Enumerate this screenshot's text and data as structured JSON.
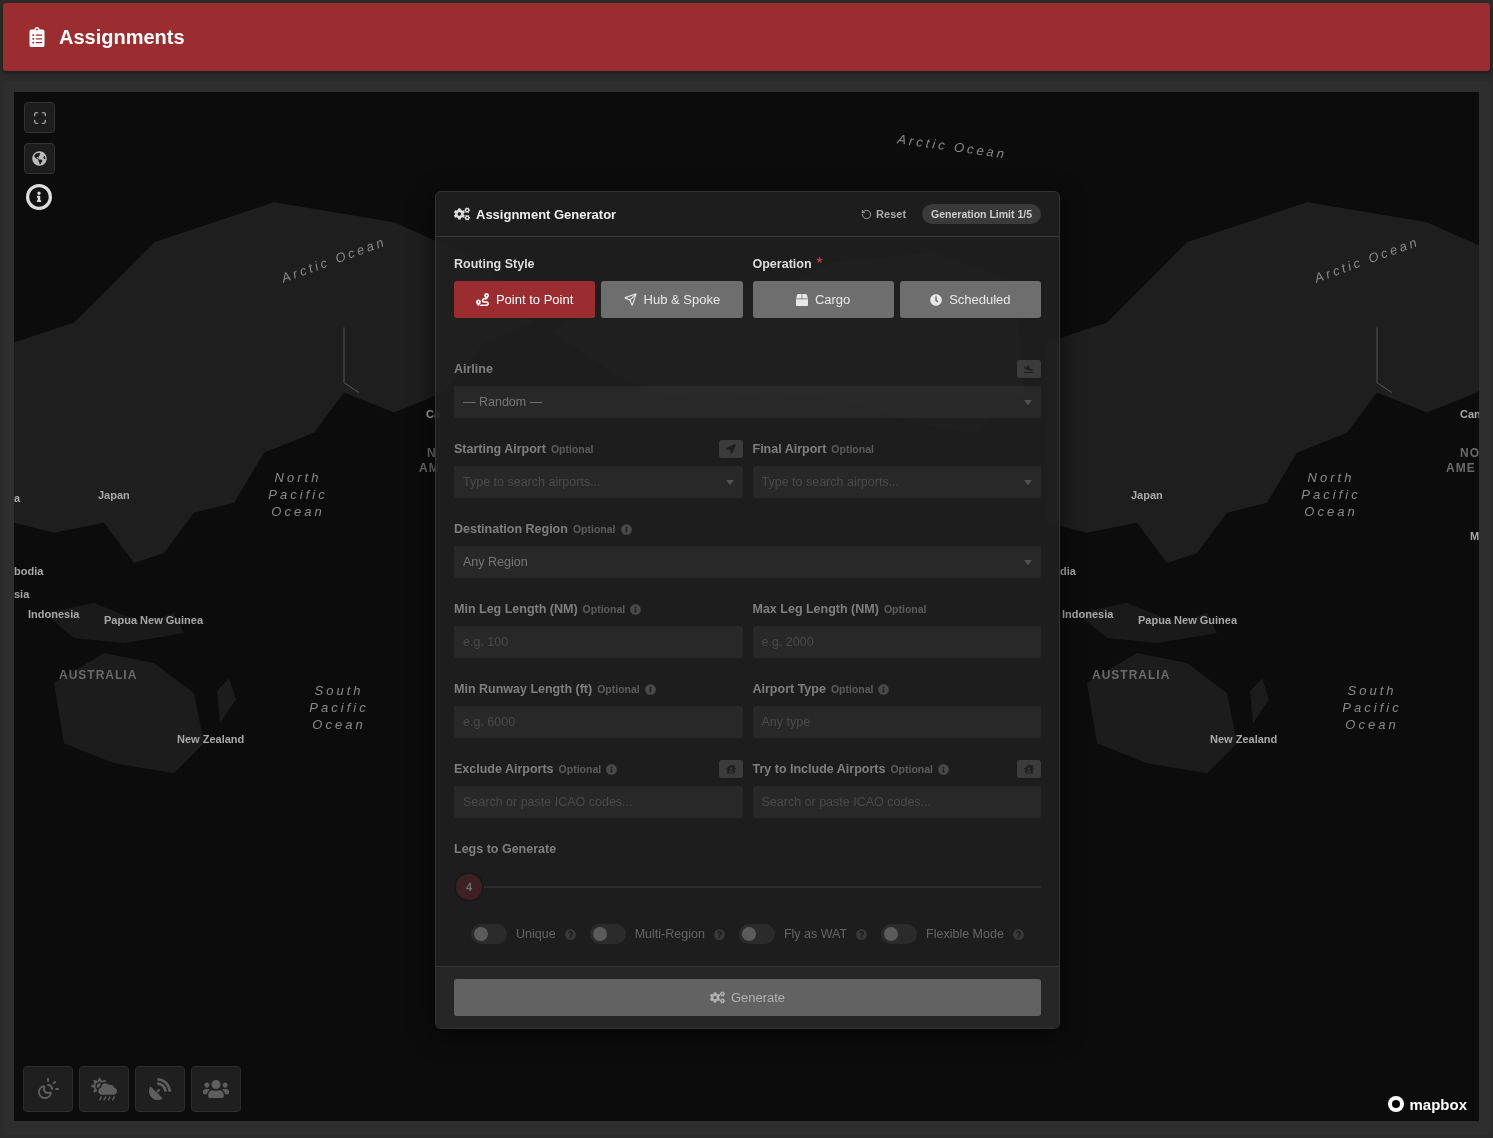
{
  "header": {
    "title": "Assignments"
  },
  "map": {
    "labels": [
      {
        "text": "Arctic Ocean",
        "kind": "ocean"
      },
      {
        "text": "Arctic Ocean",
        "kind": "ocean"
      },
      {
        "text": "Arctic Ocean",
        "kind": "ocean"
      },
      {
        "text": "North Pacific Ocean",
        "kind": "ocean"
      },
      {
        "text": "North Pacific Ocean",
        "kind": "ocean"
      },
      {
        "text": "South Pacific Ocean",
        "kind": "ocean"
      },
      {
        "text": "South Pacific Ocean",
        "kind": "ocean"
      },
      {
        "text": "Japan",
        "kind": "country"
      },
      {
        "text": "Japan",
        "kind": "country"
      },
      {
        "text": "Papua New Guinea",
        "kind": "country"
      },
      {
        "text": "Papua New Guinea",
        "kind": "country"
      },
      {
        "text": "Indonesia",
        "kind": "country"
      },
      {
        "text": "Indonesia",
        "kind": "country"
      },
      {
        "text": "AUSTRALIA",
        "kind": "continent"
      },
      {
        "text": "AUSTRALIA",
        "kind": "continent"
      },
      {
        "text": "New Zealand",
        "kind": "country"
      },
      {
        "text": "New Zealand",
        "kind": "country"
      },
      {
        "text": "a",
        "kind": "country"
      },
      {
        "text": "bodia",
        "kind": "country"
      },
      {
        "text": "sia",
        "kind": "country"
      },
      {
        "text": "dia",
        "kind": "country"
      },
      {
        "text": "Ca",
        "kind": "country"
      },
      {
        "text": "Can",
        "kind": "country"
      },
      {
        "text": "M",
        "kind": "country"
      },
      {
        "text": "N",
        "kind": "continent"
      },
      {
        "text": "AM",
        "kind": "continent"
      },
      {
        "text": "NO",
        "kind": "continent"
      },
      {
        "text": "AME",
        "kind": "continent"
      }
    ],
    "attribution": "mapbox"
  },
  "generator": {
    "title": "Assignment Generator",
    "reset": "Reset",
    "limit_badge": "Generation Limit 1/5",
    "routing": {
      "label": "Routing Style",
      "options": [
        {
          "label": "Point to Point",
          "selected": true
        },
        {
          "label": "Hub & Spoke",
          "selected": false
        }
      ]
    },
    "operation": {
      "label": "Operation",
      "required_mark": "*",
      "options": [
        {
          "label": "Cargo",
          "selected": false
        },
        {
          "label": "Scheduled",
          "selected": false
        }
      ]
    },
    "form_disabled": true,
    "rows": [
      [
        {
          "label": "Airline",
          "kind": "select",
          "value": "— Random —",
          "action": true
        }
      ],
      [
        {
          "label": "Starting Airport",
          "optional": "Optional",
          "kind": "select",
          "placeholder": "Type to search airports...",
          "action": true
        },
        {
          "label": "Final Airport",
          "optional": "Optional",
          "kind": "select",
          "placeholder": "Type to search airports..."
        }
      ],
      [
        {
          "label": "Destination Region",
          "optional": "Optional",
          "info": true,
          "kind": "select",
          "value": "Any Region"
        }
      ],
      [
        {
          "label": "Min Leg Length (NM)",
          "optional": "Optional",
          "info": true,
          "kind": "input",
          "placeholder": "e.g. 100"
        },
        {
          "label": "Max Leg Length (NM)",
          "optional": "Optional",
          "kind": "input",
          "placeholder": "e.g. 2000"
        }
      ],
      [
        {
          "label": "Min Runway Length (ft)",
          "optional": "Optional",
          "info": true,
          "kind": "input",
          "placeholder": "e.g. 6000"
        },
        {
          "label": "Airport Type",
          "optional": "Optional",
          "info": true,
          "kind": "input",
          "placeholder": "Any type"
        }
      ],
      [
        {
          "label": "Exclude Airports",
          "optional": "Optional",
          "info": true,
          "kind": "input",
          "placeholder": "Search or paste ICAO codes...",
          "action": true
        },
        {
          "label": "Try to Include Airports",
          "optional": "Optional",
          "info": true,
          "kind": "input",
          "placeholder": "Search or paste ICAO codes...",
          "action": true
        }
      ]
    ],
    "legs": {
      "label": "Legs to Generate",
      "value": "4",
      "level": 0
    },
    "toggles": [
      {
        "label": "Unique",
        "on": false
      },
      {
        "label": "Multi-Region",
        "on": false
      },
      {
        "label": "Fly as WAT",
        "on": false
      },
      {
        "label": "Flexible Mode",
        "on": false
      }
    ],
    "generate": {
      "label": "Generate",
      "disabled": true
    }
  }
}
